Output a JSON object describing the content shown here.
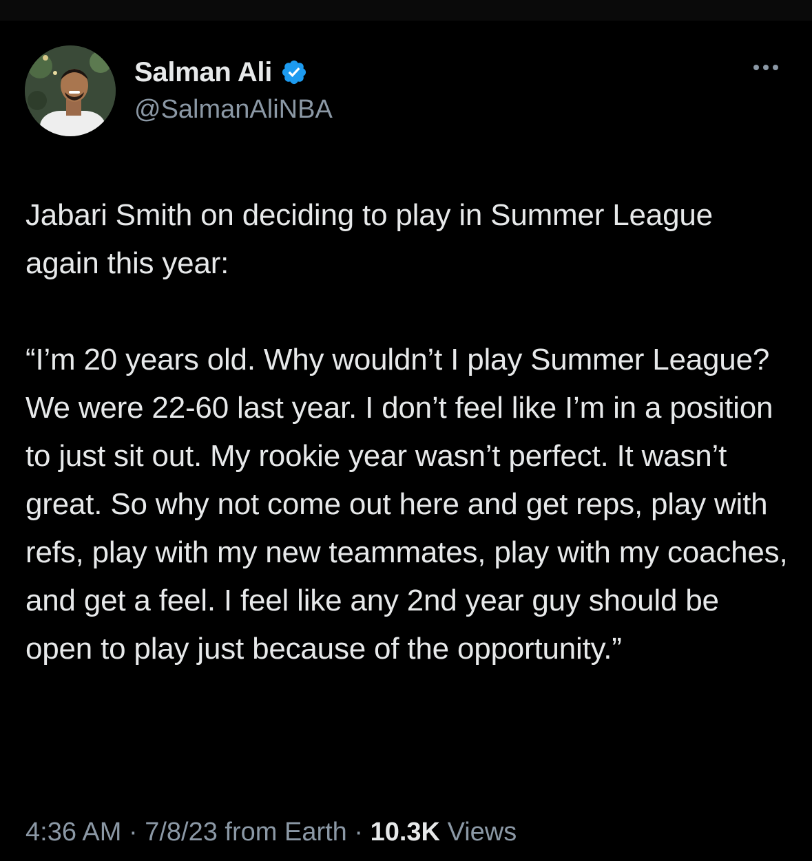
{
  "author": {
    "display_name": "Salman Ali",
    "handle": "@SalmanAliNBA",
    "verified": true,
    "verified_color": "#1d9bf0"
  },
  "icons": {
    "more": "more-options-icon",
    "verified": "verified-badge-icon",
    "avatar": "profile-avatar"
  },
  "tweet": {
    "text": "Jabari Smith on deciding to play in Summer League again this year:\n\n“I’m 20 years old. Why wouldn’t I play Summer League? We were 22-60 last year. I don’t feel like I’m in a position to just sit out. My rookie year wasn’t perfect. It wasn’t great. So why not come out here and get reps, play with refs, play with my new teammates, play with my coaches, and get a feel. I feel like any 2nd year guy should be open to play just because of the opportunity.”"
  },
  "meta": {
    "time": "4:36 AM",
    "separator": "·",
    "date": "7/8/23",
    "source": "from Earth",
    "views_count": "10.3K",
    "views_label": "Views"
  },
  "colors": {
    "background": "#000000",
    "text_primary": "#e7e9ea",
    "text_secondary": "#8b98a5"
  }
}
